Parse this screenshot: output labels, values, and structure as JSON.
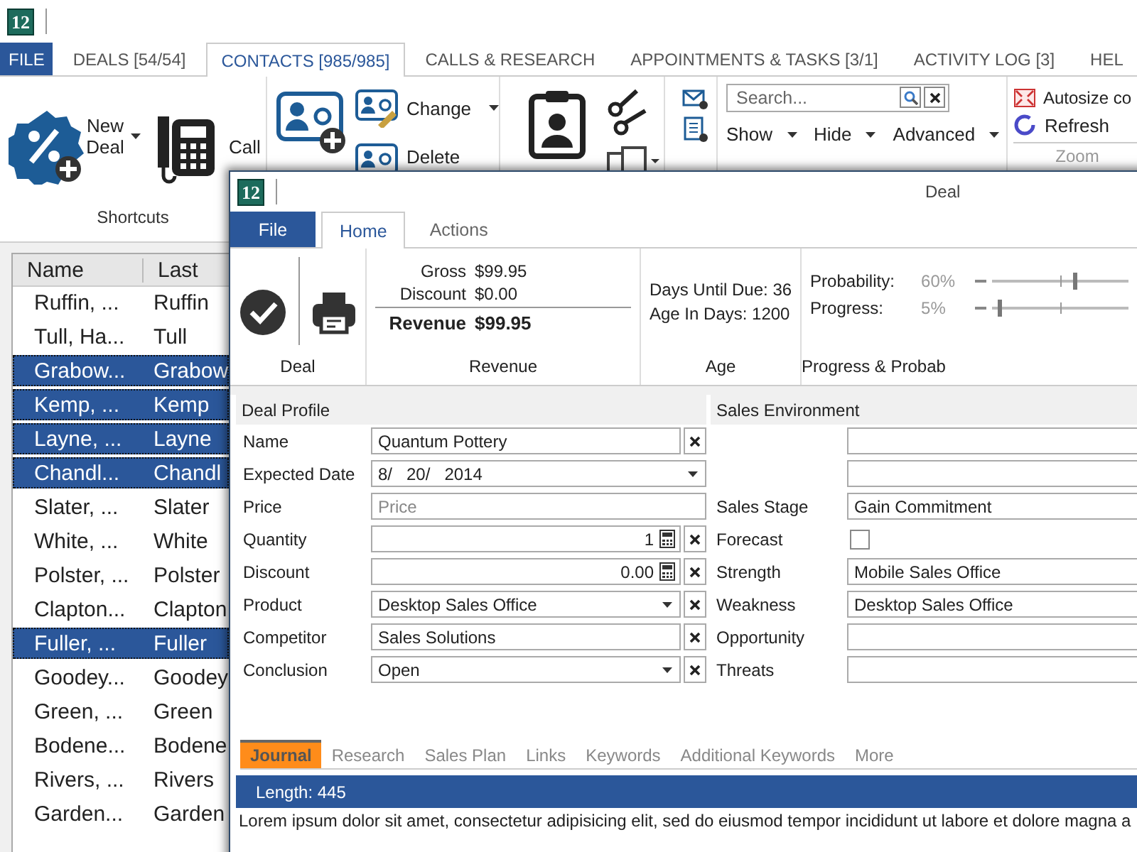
{
  "app": {
    "logo": "12",
    "file_tab": "FILE"
  },
  "main_tabs": [
    {
      "label": "DEALS [54/54]",
      "selected": false
    },
    {
      "label": "CONTACTS [985/985]",
      "selected": true
    },
    {
      "label": "CALLS & RESEARCH",
      "selected": false
    },
    {
      "label": "APPOINTMENTS & TASKS [3/1]",
      "selected": false
    },
    {
      "label": "ACTIVITY LOG [3]",
      "selected": false
    },
    {
      "label": "HEL",
      "selected": false
    }
  ],
  "ribbon": {
    "new_deal": "New Deal",
    "call": "Call",
    "shortcuts_title": "Shortcuts",
    "change": "Change",
    "delete": "Delete",
    "search": {
      "placeholder": "Search..."
    },
    "view_buttons": [
      "Show",
      "Hide",
      "Advanced"
    ],
    "autosize": "Autosize co",
    "refresh": "Refresh",
    "zoom_title": "Zoom"
  },
  "contact_list": {
    "columns": [
      "Name",
      "Last"
    ],
    "rows": [
      {
        "cells": [
          "Ruffin, ...",
          "Ruffin"
        ],
        "selected": false
      },
      {
        "cells": [
          "Tull, Ha...",
          "Tull"
        ],
        "selected": false
      },
      {
        "cells": [
          "Grabow...",
          "Grabow"
        ],
        "selected": true
      },
      {
        "cells": [
          "Kemp, ...",
          "Kemp"
        ],
        "selected": true
      },
      {
        "cells": [
          "Layne, ...",
          "Layne"
        ],
        "selected": true
      },
      {
        "cells": [
          "Chandl...",
          "Chandl"
        ],
        "selected": true
      },
      {
        "cells": [
          "Slater, ...",
          "Slater"
        ],
        "selected": false
      },
      {
        "cells": [
          "White, ...",
          "White"
        ],
        "selected": false
      },
      {
        "cells": [
          "Polster, ...",
          "Polster"
        ],
        "selected": false
      },
      {
        "cells": [
          "Clapton...",
          "Clapton"
        ],
        "selected": false
      },
      {
        "cells": [
          "Fuller, ...",
          "Fuller"
        ],
        "selected": true
      },
      {
        "cells": [
          "Goodey...",
          "Goodey"
        ],
        "selected": false
      },
      {
        "cells": [
          "Green, ...",
          "Green"
        ],
        "selected": false
      },
      {
        "cells": [
          "Bodene...",
          "Bodene"
        ],
        "selected": false
      },
      {
        "cells": [
          "Rivers, ...",
          "Rivers"
        ],
        "selected": false
      },
      {
        "cells": [
          "Garden...",
          "Garden"
        ],
        "selected": false
      }
    ]
  },
  "deal_window": {
    "logo": "12",
    "title": "Deal",
    "file_tab": "File",
    "tabs": [
      {
        "label": "Home",
        "selected": true
      },
      {
        "label": "Actions",
        "selected": false
      }
    ],
    "ribbon": {
      "deal_title": "Deal",
      "revenue": {
        "title": "Revenue",
        "rows": [
          {
            "label": "Gross",
            "value": "$99.95",
            "kind": "item"
          },
          {
            "label": "Discount",
            "value": "$0.00",
            "kind": "item"
          },
          {
            "label": "Revenue",
            "value": "$99.95",
            "kind": "total"
          }
        ]
      },
      "age": {
        "title": "Age",
        "lines": [
          "Days Until Due: 36",
          "Age In Days: 1200"
        ]
      },
      "progress": {
        "title": "Progress & Probab",
        "sliders": [
          {
            "label": "Probability:",
            "reading": "60%",
            "level": 0.6
          },
          {
            "label": "Progress:",
            "reading": "5%",
            "level": 0.05
          }
        ]
      }
    },
    "deal_profile": {
      "title": "Deal Profile",
      "fields": [
        {
          "label": "Name",
          "kind": "text",
          "value": "Quantum Pottery"
        },
        {
          "label": "Expected Date",
          "kind": "date",
          "value": "8/   20/   2014"
        },
        {
          "label": "Price",
          "kind": "placeholder",
          "placeholder": "Price"
        },
        {
          "label": "Quantity",
          "kind": "number",
          "value": "1"
        },
        {
          "label": "Discount",
          "kind": "number",
          "value": "0.00"
        },
        {
          "label": "Product",
          "kind": "dropdown",
          "value": "Desktop Sales Office"
        },
        {
          "label": "Competitor",
          "kind": "text",
          "value": "Sales Solutions"
        },
        {
          "label": "Conclusion",
          "kind": "dropdown",
          "value": "Open"
        }
      ]
    },
    "sales_environment": {
      "title": "Sales Environment",
      "fields": [
        {
          "kind": "plain"
        },
        {
          "kind": "plain"
        },
        {
          "label": "Sales Stage",
          "kind": "plain",
          "value": "Gain Commitment"
        },
        {
          "label": "Forecast",
          "kind": "checkbox",
          "checked": false
        },
        {
          "label": "Strength",
          "kind": "plain",
          "value": "Mobile Sales Office"
        },
        {
          "label": "Weakness",
          "kind": "plain",
          "value": "Desktop Sales Office"
        },
        {
          "label": "Opportunity",
          "kind": "plain"
        },
        {
          "label": "Threats",
          "kind": "plain"
        }
      ]
    },
    "bottom_tabs": [
      {
        "label": "Journal",
        "selected": true
      },
      {
        "label": "Research",
        "selected": false
      },
      {
        "label": "Sales Plan",
        "selected": false
      },
      {
        "label": "Links",
        "selected": false
      },
      {
        "label": "Keywords",
        "selected": false
      },
      {
        "label": "Additional Keywords",
        "selected": false
      },
      {
        "label": "More",
        "selected": false
      }
    ],
    "journal": {
      "length": "Length: 445",
      "text": "Lorem ipsum dolor sit amet, consectetur adipisicing elit, sed do eiusmod tempor incididunt ut labore et dolore magna a"
    }
  }
}
